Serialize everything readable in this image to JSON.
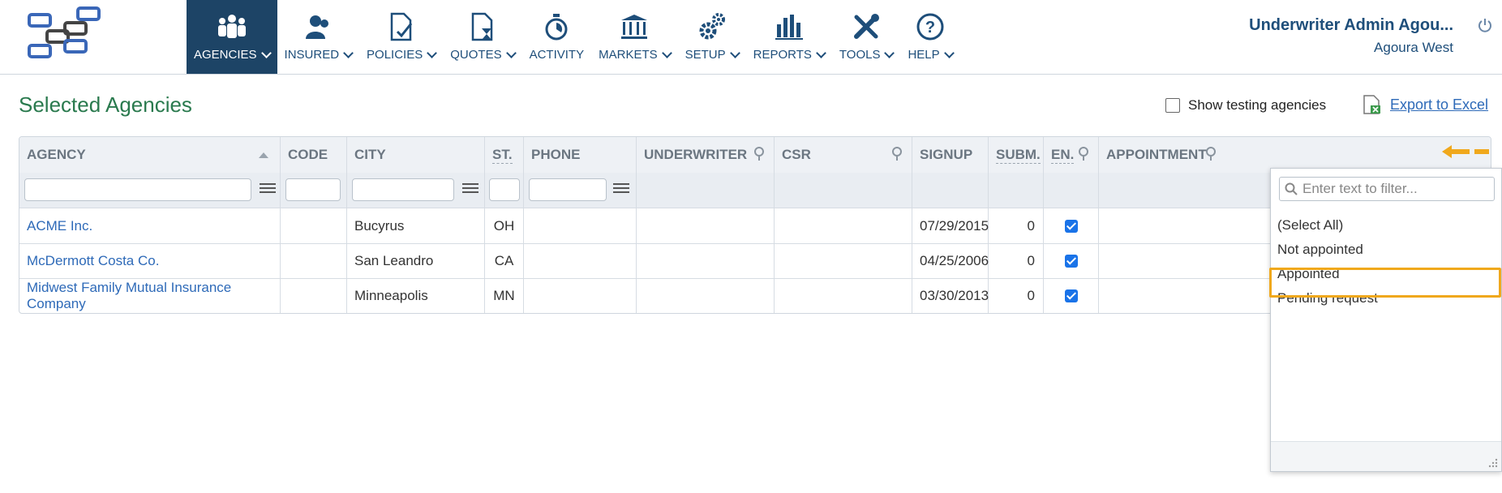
{
  "nav": {
    "items": [
      {
        "label": "AGENCIES",
        "icon": "people-icon",
        "chevron": true
      },
      {
        "label": "INSURED",
        "icon": "user-icon",
        "chevron": true
      },
      {
        "label": "POLICIES",
        "icon": "document-check-icon",
        "chevron": true
      },
      {
        "label": "QUOTES",
        "icon": "document-hourglass-icon",
        "chevron": true
      },
      {
        "label": "ACTIVITY",
        "icon": "stopwatch-icon",
        "chevron": false
      },
      {
        "label": "MARKETS",
        "icon": "bank-icon",
        "chevron": true
      },
      {
        "label": "SETUP",
        "icon": "gears-icon",
        "chevron": true
      },
      {
        "label": "REPORTS",
        "icon": "bar-chart-icon",
        "chevron": true
      },
      {
        "label": "TOOLS",
        "icon": "tools-icon",
        "chevron": true
      },
      {
        "label": "HELP",
        "icon": "question-icon",
        "chevron": true
      }
    ],
    "active_index": 0
  },
  "user": {
    "name": "Underwriter Admin Agou...",
    "location": "Agoura West"
  },
  "page": {
    "title": "Selected Agencies",
    "show_testing_label": "Show testing agencies",
    "export_label": "Export to Excel"
  },
  "grid": {
    "columns": [
      "AGENCY",
      "CODE",
      "CITY",
      "ST.",
      "PHONE",
      "UNDERWRITER",
      "CSR",
      "SIGNUP",
      "SUBM.",
      "EN.",
      "APPOINTMENT"
    ],
    "rows": [
      {
        "agency": "ACME Inc.",
        "code": "",
        "city": "Bucyrus",
        "st": "OH",
        "phone": "",
        "underwriter": "",
        "csr": "",
        "signup": "07/29/2015",
        "subm": "0",
        "en": true
      },
      {
        "agency": "McDermott Costa Co.",
        "code": "",
        "city": "San Leandro",
        "st": "CA",
        "phone": "",
        "underwriter": "",
        "csr": "",
        "signup": "04/25/2006",
        "subm": "0",
        "en": true
      },
      {
        "agency": "Midwest Family Mutual Insurance Company",
        "code": "",
        "city": "Minneapolis",
        "st": "MN",
        "phone": "",
        "underwriter": "",
        "csr": "",
        "signup": "03/30/2013",
        "subm": "0",
        "en": true
      }
    ]
  },
  "filter_popup": {
    "placeholder": "Enter text to filter...",
    "options": [
      "(Select All)",
      "Not appointed",
      "Appointed",
      "Pending request"
    ],
    "highlighted": "Appointed"
  },
  "colors": {
    "nav_active": "#1d4466",
    "brand_blue": "#1e4e7a",
    "title_green": "#2a7a4e",
    "link": "#2e6ab8",
    "highlight": "#f0a81c"
  }
}
